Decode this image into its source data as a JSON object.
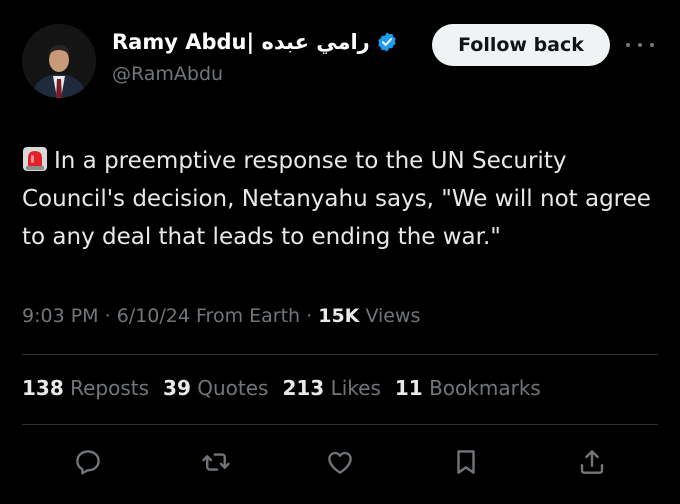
{
  "author": {
    "display_name": "Ramy Abdu| رامي عبده",
    "handle": "@RamAbdu",
    "verified_badge": "verified-badge-icon",
    "badge_color": "#1d9bf0"
  },
  "follow_button": {
    "label": "Follow back"
  },
  "more_menu": {
    "icon": "more-horizontal-icon"
  },
  "tweet": {
    "emoji": "rotating-light-siren-icon",
    "text": "In a preemptive response to the UN Security Council's decision, Netanyahu says, \"We will not agree to any deal that leads to ending the war.\""
  },
  "meta": {
    "time": "9:03 PM",
    "separator": "·",
    "date": "6/10/24",
    "source": "From Earth",
    "views_count": "15K",
    "views_label": "Views"
  },
  "stats": {
    "reposts_count": "138",
    "reposts_label": "Reposts",
    "quotes_count": "39",
    "quotes_label": "Quotes",
    "likes_count": "213",
    "likes_label": "Likes",
    "bookmarks_count": "11",
    "bookmarks_label": "Bookmarks"
  },
  "actions": [
    {
      "icon": "reply-icon"
    },
    {
      "icon": "repost-icon"
    },
    {
      "icon": "like-icon"
    },
    {
      "icon": "bookmark-icon"
    },
    {
      "icon": "share-icon"
    }
  ],
  "colors": {
    "background": "#000000",
    "text_primary": "#e7e9ea",
    "text_secondary": "#71767b",
    "divider": "#2f3336",
    "follow_button_bg": "#eff3f4"
  }
}
